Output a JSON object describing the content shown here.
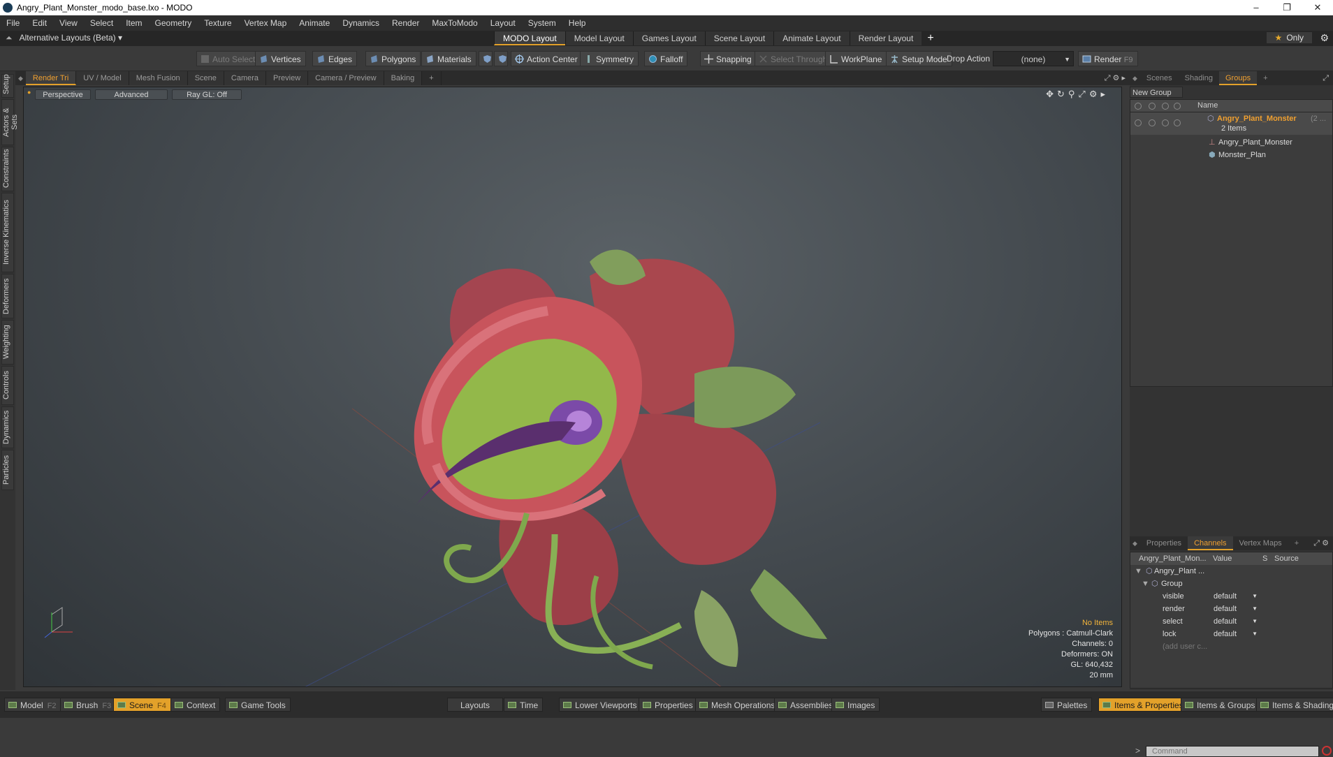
{
  "window": {
    "title": "Angry_Plant_Monster_modo_base.lxo - MODO",
    "controls": [
      "–",
      "❐",
      "✕"
    ]
  },
  "menu": [
    "File",
    "Edit",
    "View",
    "Select",
    "Item",
    "Geometry",
    "Texture",
    "Vertex Map",
    "Animate",
    "Dynamics",
    "Render",
    "MaxToModo",
    "Layout",
    "System",
    "Help"
  ],
  "layoutbar": {
    "alt_layout": "Alternative Layouts (Beta) ▾",
    "tabs": [
      "MODO Layout",
      "Model Layout",
      "Games Layout",
      "Scene Layout",
      "Animate Layout",
      "Render Layout"
    ],
    "active_tab": "MODO Layout",
    "plus": "+",
    "only_label": "Only",
    "star": "★"
  },
  "toolbar": {
    "auto_select": "Auto Select",
    "vertices": "Vertices",
    "edges": "Edges",
    "polygons": "Polygons",
    "materials": "Materials",
    "action_center": "Action Center",
    "symmetry": "Symmetry",
    "falloff": "Falloff",
    "snapping": "Snapping",
    "select_through": "Select Through",
    "workplane": "WorkPlane",
    "setup_mode": "Setup Mode",
    "drop_action_label": "Drop Action",
    "drop_action_value": "(none)",
    "render": "Render",
    "render_key": "F9"
  },
  "left_tabs": [
    "Setup",
    "Actors & Sets",
    "Constraints",
    "Inverse Kinematics",
    "Deformers",
    "Weighting",
    "Controls",
    "Dynamics",
    "Particles"
  ],
  "viewport_tabs": [
    "Render Tri",
    "UV / Model",
    "Mesh Fusion",
    "Scene",
    "Camera",
    "Preview",
    "Camera / Preview",
    "Baking",
    "+"
  ],
  "viewport": {
    "view": "Perspective",
    "shading": "Advanced",
    "raygl": "Ray GL: Off",
    "info": {
      "no_items": "No Items",
      "polygons": "Polygons : Catmull-Clark",
      "channels": "Channels: 0",
      "deformers": "Deformers: ON",
      "gl": "GL: 640,432",
      "size": "20 mm"
    }
  },
  "right_top_tabs": [
    "Scenes",
    "Shading",
    "Groups",
    "+"
  ],
  "groups": {
    "new_group": "New Group",
    "header_name": "Name",
    "root_name": "Angry_Plant_Monster",
    "root_suffix": "(2 ...",
    "root_count": "2 Items",
    "children": [
      "Angry_Plant_Monster",
      "Monster_Plan"
    ]
  },
  "right_bottom_tabs": [
    "Properties",
    "Channels",
    "Vertex Maps",
    "+"
  ],
  "channels": {
    "col_name": "Angry_Plant_Mon...",
    "col_value": "Value",
    "col_s": "S",
    "col_source": "Source",
    "item": "Angry_Plant ...",
    "group": "Group",
    "rows": [
      {
        "name": "visible",
        "value": "default"
      },
      {
        "name": "render",
        "value": "default"
      },
      {
        "name": "select",
        "value": "default"
      },
      {
        "name": "lock",
        "value": "default"
      }
    ],
    "add_user": "(add user c..."
  },
  "command": {
    "prompt": ">",
    "placeholder": "Command"
  },
  "bottombar": {
    "left": [
      {
        "label": "Model",
        "key": "F2"
      },
      {
        "label": "Brush",
        "key": "F3"
      },
      {
        "label": "Scene",
        "key": "F4"
      },
      {
        "label": "Context",
        "key": ""
      },
      {
        "label": "Game Tools",
        "key": ""
      }
    ],
    "middle": [
      "Layouts",
      "Time",
      "Lower Viewports",
      "Properties",
      "Mesh Operations",
      "Assemblies",
      "Images"
    ],
    "right": [
      "Palettes",
      "Items & Properties",
      "Items & Groups",
      "Items & Shading"
    ]
  },
  "colors": {
    "accent": "#e3a12a",
    "background": "#3a3a3a",
    "viewport": "#4a5055"
  }
}
